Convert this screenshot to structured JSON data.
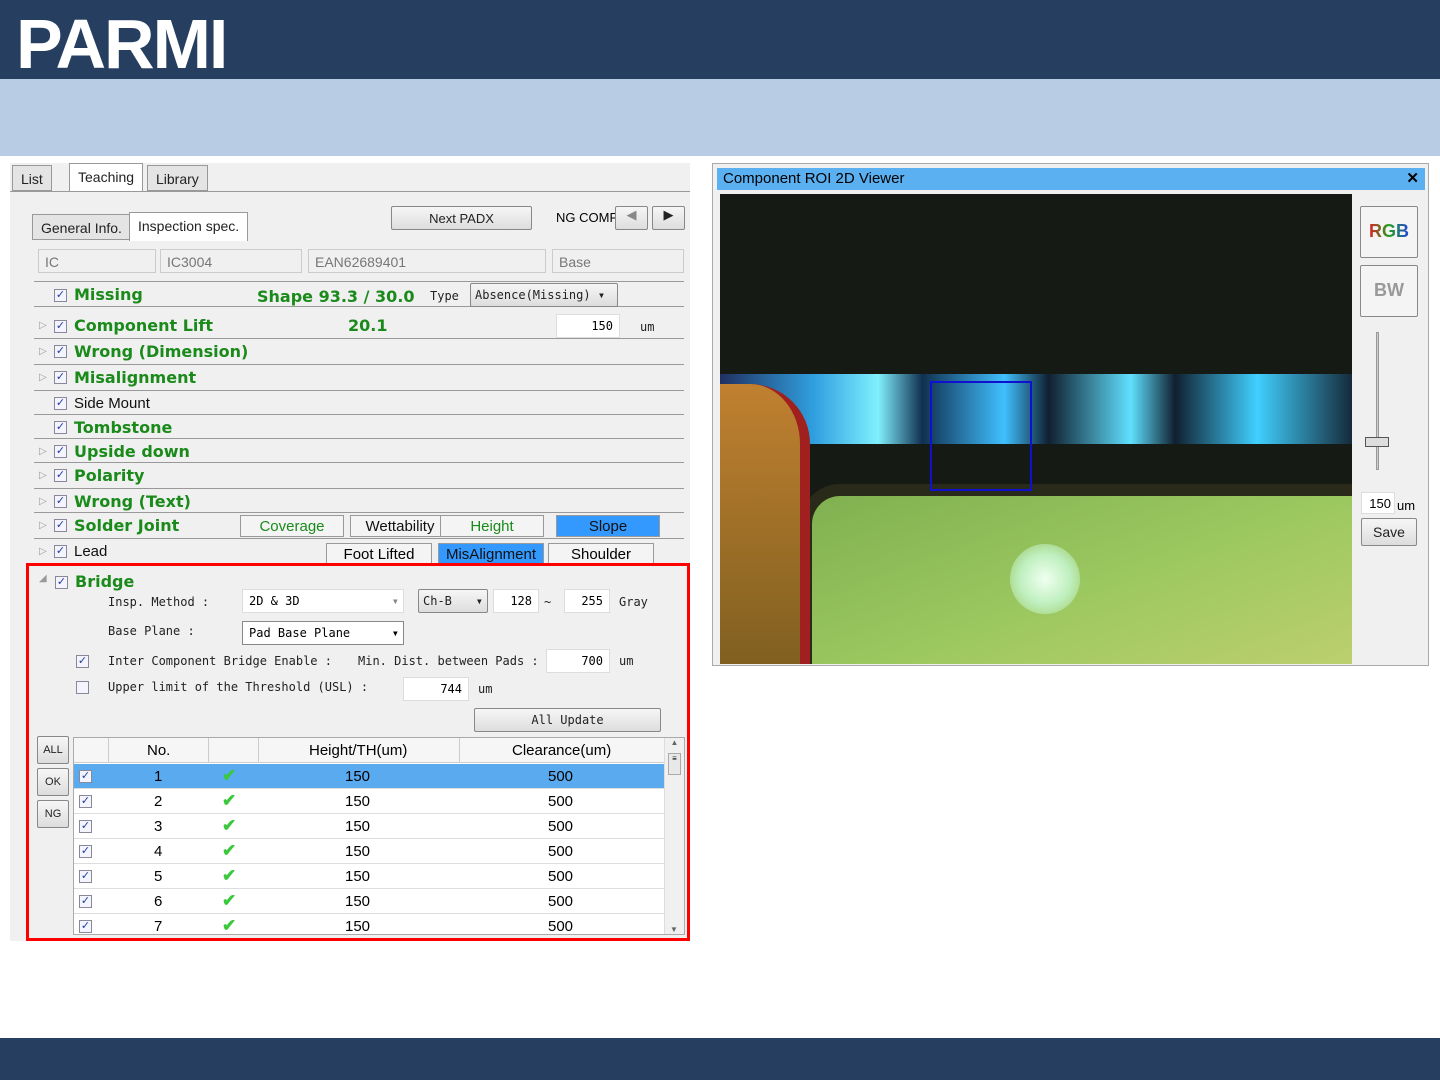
{
  "brand": {
    "logo": "PARMI"
  },
  "tabs": [
    "List",
    "Teaching",
    "Library"
  ],
  "subtabs": [
    "General Info.",
    "Inspection spec."
  ],
  "nav": {
    "next": "Next PADX",
    "ng_comp": "NG COMP"
  },
  "info": [
    "IC",
    "IC3004",
    "EAN62689401",
    "Base"
  ],
  "missing": {
    "label": "Missing",
    "shape": "Shape 93.3 / 30.0",
    "type_label": "Type",
    "type_value": "Absence(Missing)"
  },
  "lift": {
    "label": "Component  Lift",
    "value": "20.1",
    "input": "150",
    "unit": "um"
  },
  "items": [
    "Wrong (Dimension)",
    "Misalignment",
    "Side Mount",
    "Tombstone",
    "Upside down",
    "Polarity",
    "Wrong (Text)",
    "Solder Joint",
    "Lead"
  ],
  "solder_buttons": [
    "Coverage",
    "Wettability",
    "Height",
    "Slope"
  ],
  "lead_buttons": [
    "Foot Lifted",
    "MisAlignment",
    "Shoulder"
  ],
  "bridge": {
    "label": "Bridge",
    "method_label": "Insp. Method :",
    "method": "2D & 3D",
    "channel": "Ch-B",
    "min": "128",
    "tilde": "~",
    "max": "255",
    "gray": "Gray",
    "base_label": "Base Plane :",
    "base": "Pad Base Plane",
    "inter_label": "Inter Component Bridge Enable :",
    "dist_label": "Min. Dist. between Pads :",
    "dist": "700",
    "unit": "um",
    "usl_label": "Upper limit of the Threshold (USL)  :",
    "usl": "744",
    "update": "All Update"
  },
  "side_buttons": [
    "ALL",
    "OK",
    "NG"
  ],
  "table": {
    "headers": [
      "No.",
      "",
      "Height/TH(um)",
      "Clearance(um)"
    ],
    "rows": [
      [
        "1",
        "150",
        "500"
      ],
      [
        "2",
        "150",
        "500"
      ],
      [
        "3",
        "150",
        "500"
      ],
      [
        "4",
        "150",
        "500"
      ],
      [
        "5",
        "150",
        "500"
      ],
      [
        "6",
        "150",
        "500"
      ],
      [
        "7",
        "150",
        "500"
      ]
    ]
  },
  "viewer": {
    "title": "Component ROI 2D Viewer",
    "close": "✕",
    "rgb": "RGB",
    "bw": "BW",
    "value": "150",
    "unit": "um",
    "save": "Save"
  }
}
